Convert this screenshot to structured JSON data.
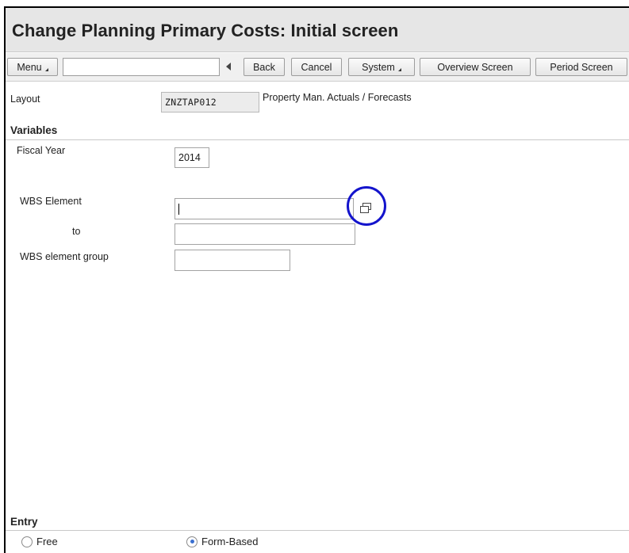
{
  "window": {
    "title": "Change Planning Primary Costs: Initial screen"
  },
  "toolbar": {
    "menu_label": "Menu",
    "command_field_value": "",
    "back_label": "Back",
    "cancel_label": "Cancel",
    "system_label": "System",
    "overview_label": "Overview Screen",
    "period_label": "Period Screen"
  },
  "layout": {
    "label": "Layout",
    "code": "ZNZTAP012",
    "description": "Property Man. Actuals / Forecasts"
  },
  "variables": {
    "section_title": "Variables",
    "fiscal_year_label": "Fiscal Year",
    "fiscal_year_value": "2014",
    "wbs_element_label": "WBS Element",
    "wbs_element_from": "",
    "to_label": "to",
    "wbs_element_to": "",
    "wbs_group_label": "WBS element group",
    "wbs_group_value": ""
  },
  "entry": {
    "section_title": "Entry",
    "options": [
      "Free",
      "Form-Based"
    ],
    "selected": "Form-Based"
  },
  "icons": {
    "multiple_selection": "multiple-selection-icon",
    "nav_back": "triangle-left-icon"
  },
  "colors": {
    "highlight_ring": "#1414cc",
    "title_bar": "#e6e6e6",
    "radio_selected": "#3a6fd0"
  }
}
